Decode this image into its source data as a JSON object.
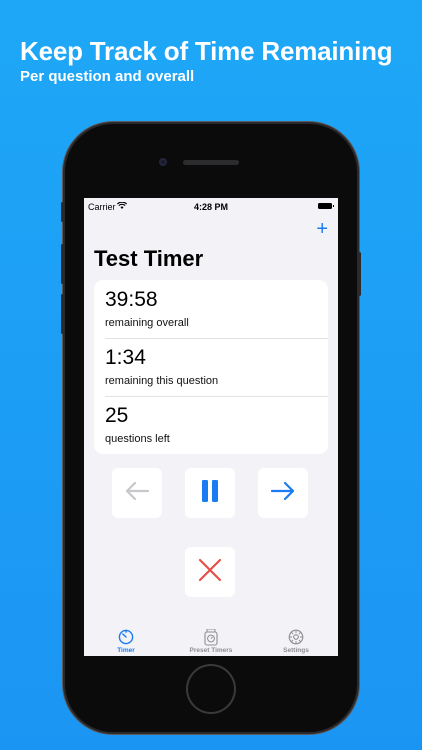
{
  "promo": {
    "title": "Keep Track of Time Remaining",
    "subtitle": "Per question and overall"
  },
  "status_bar": {
    "carrier": "Carrier",
    "time": "4:28 PM"
  },
  "nav": {
    "add_label": "+"
  },
  "screen_title": "Test Timer",
  "stats": [
    {
      "value": "39:58",
      "label": "remaining overall"
    },
    {
      "value": "1:34",
      "label": "remaining this question"
    },
    {
      "value": "25",
      "label": "questions left"
    }
  ],
  "controls": {
    "previous_icon": "arrow-left-icon",
    "pause_icon": "pause-icon",
    "next_icon": "arrow-right-icon",
    "stop_icon": "x-icon"
  },
  "tabs": [
    {
      "label": "Timer",
      "icon": "timer-icon",
      "active": true
    },
    {
      "label": "Preset Timers",
      "icon": "stopwatch-icon",
      "active": false
    },
    {
      "label": "Settings",
      "icon": "gear-icon",
      "active": false
    }
  ],
  "colors": {
    "accent": "#1a7cf2",
    "disabled": "#c7c7cc",
    "stop": "#e5504a",
    "background": "#1ea7f7"
  }
}
